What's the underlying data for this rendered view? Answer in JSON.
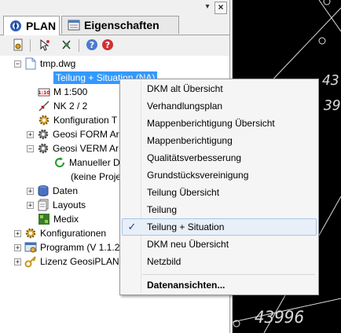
{
  "window": {
    "pin_glyph": "▾",
    "close_glyph": "×"
  },
  "tabs": [
    {
      "label": "PLAN",
      "icon": "plan-icon",
      "active": true
    },
    {
      "label": "Eigenschaften",
      "icon": "properties-icon",
      "active": false
    }
  ],
  "toolbar": {
    "buttons": [
      "document-settings-icon",
      "select-tool-icon",
      "node-tool-icon",
      "help-icon",
      "stop-icon"
    ]
  },
  "tree": {
    "root": {
      "label": "tmp.dwg",
      "icon": "drawing-file-icon"
    },
    "selected": {
      "label": "Teilung + Situation (NA)"
    },
    "scale": {
      "label": "M 1:500",
      "badge": "1:10"
    },
    "nk": {
      "label": "NK 2 / 2"
    },
    "konfig_t": {
      "label": "Konfiguration T"
    },
    "form": {
      "label": "Geosi FORM Ar"
    },
    "verm": {
      "label": "Geosi VERM Ar"
    },
    "manuell": {
      "label": "Manueller D"
    },
    "keine": {
      "label": "(keine Proje"
    },
    "daten": {
      "label": "Daten"
    },
    "layouts": {
      "label": "Layouts"
    },
    "medix": {
      "label": "Medix"
    },
    "konfigurationen": {
      "label": "Konfigurationen"
    },
    "programm": {
      "label": "Programm (V 1.1.2"
    },
    "lizenz": {
      "label": "Lizenz GeosiPLAN"
    }
  },
  "context_menu": {
    "items": [
      {
        "label": "DKM alt Übersicht",
        "checked": false
      },
      {
        "label": "Verhandlungsplan",
        "checked": false
      },
      {
        "label": "Mappenberichtigung Übersicht",
        "checked": false
      },
      {
        "label": "Mappenberichtigung",
        "checked": false
      },
      {
        "label": "Qualitätsverbesserung",
        "checked": false
      },
      {
        "label": "Grundstücksvereinigung",
        "checked": false
      },
      {
        "label": "Teilung Übersicht",
        "checked": false
      },
      {
        "label": "Teilung",
        "checked": false
      },
      {
        "label": "Teilung + Situation",
        "checked": true
      },
      {
        "label": "DKM neu Übersicht",
        "checked": false
      },
      {
        "label": "Netzbild",
        "checked": false
      }
    ],
    "footer_item": {
      "label": "Datenansichten..."
    },
    "check_glyph": "✓"
  },
  "cad": {
    "labels": [
      "43",
      "39",
      "43996"
    ],
    "colors": {
      "background": "#000000",
      "lines": "#e0e0e0"
    }
  },
  "colors": {
    "selection": "#3399ff",
    "accent": "#1e3f85"
  }
}
